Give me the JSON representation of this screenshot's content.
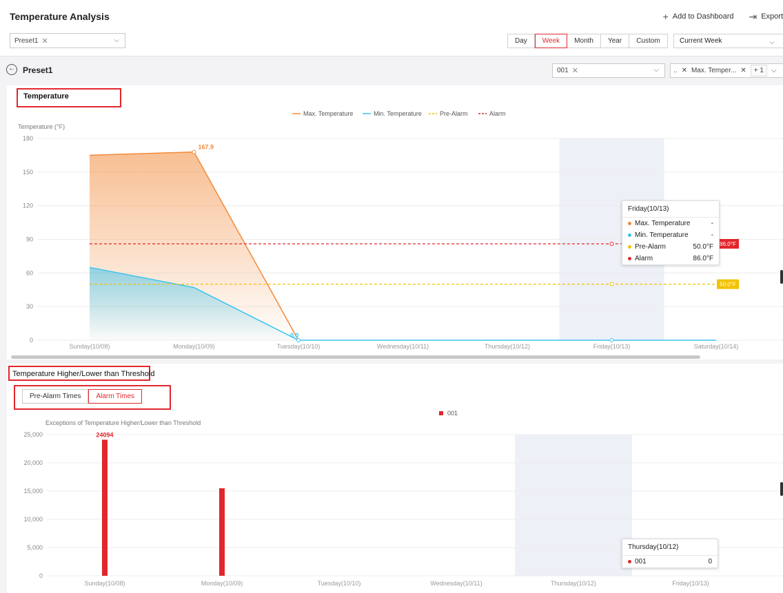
{
  "app": {
    "title": "Temperature Analysis"
  },
  "toolbar": {
    "add_dashboard": "Add to Dashboard",
    "export": "Export"
  },
  "preset_filter": {
    "tag": "Preset1"
  },
  "period_tabs": [
    "Day",
    "Week",
    "Month",
    "Year",
    "Custom"
  ],
  "period_active": "Week",
  "range_select": "Current Week",
  "preset_row": {
    "name": "Preset1",
    "device_tag": "001",
    "metric_prefix": "..",
    "metric_tag": "Max. Temper...",
    "metric_more": "+ 1"
  },
  "chart1": {
    "section_title": "Temperature",
    "ylabel": "Temperature (°F)",
    "tooltip": {
      "title": "Friday(10/13)",
      "rows": [
        {
          "label": "Max. Temperature",
          "value": "-",
          "color": "#f28a3a"
        },
        {
          "label": "Min. Temperature",
          "value": "-",
          "color": "#3bc3ee"
        },
        {
          "label": "Pre-Alarm",
          "value": "50.0°F",
          "color": "#f2c200"
        },
        {
          "label": "Alarm",
          "value": "86.0°F",
          "color": "#e2262d"
        }
      ]
    },
    "alarm_badge": "86.0°F",
    "prealarm_badge": "50.0°F"
  },
  "chart2": {
    "section_title": "Temperature Higher/Lower than Threshold",
    "tabs": [
      "Pre-Alarm Times",
      "Alarm Times"
    ],
    "active_tab": "Alarm Times",
    "ylabel": "Exceptions of Temperature Higher/Lower than Threshold",
    "tooltip": {
      "title": "Thursday(10/12)",
      "rows": [
        {
          "label": "001",
          "value": "0",
          "color": "#e2262d"
        }
      ]
    }
  },
  "colors": {
    "accent": "#e2262d",
    "max": "#f28a3a",
    "min": "#3bc3ee",
    "prealarm": "#f2c200",
    "alarm": "#e2262d"
  },
  "chart_data": [
    {
      "type": "line",
      "x": [
        "Sunday(10/08)",
        "Monday(10/09)",
        "Tuesday(10/10)",
        "Wednesday(10/11)",
        "Thursday(10/12)",
        "Friday(10/13)",
        "Saturday(10/14)"
      ],
      "series": [
        {
          "name": "Max. Temperature",
          "values": [
            165,
            167.9,
            0,
            null,
            null,
            null,
            null
          ]
        },
        {
          "name": "Min. Temperature",
          "values": [
            65,
            47,
            0,
            0,
            0,
            0,
            0
          ]
        },
        {
          "name": "Pre-Alarm",
          "values": [
            50,
            50,
            50,
            50,
            50,
            50,
            50
          ]
        },
        {
          "name": "Alarm",
          "values": [
            86,
            86,
            86,
            86,
            86,
            86,
            86
          ]
        }
      ],
      "data_labels": [
        {
          "series": "Max. Temperature",
          "x": "Monday(10/09)",
          "text": "167.9"
        },
        {
          "series": "Min. Temperature",
          "x": "Tuesday(10/10)",
          "text": "0.0"
        }
      ],
      "yticks": [
        "0",
        "30",
        "60",
        "90",
        "120",
        "150",
        "180"
      ],
      "ylim": [
        0,
        180
      ],
      "highlight": "Friday(10/13)",
      "legend": "top-center",
      "grid": true
    },
    {
      "type": "bar",
      "categories": [
        "Sunday(10/08)",
        "Monday(10/09)",
        "Tuesday(10/10)",
        "Wednesday(10/11)",
        "Thursday(10/12)",
        "Friday(10/13)"
      ],
      "series": [
        {
          "name": "001",
          "values": [
            24094,
            15500,
            0,
            0,
            0,
            0
          ]
        }
      ],
      "data_labels": [
        {
          "x": "Sunday(10/08)",
          "text": "24094"
        }
      ],
      "yticks": [
        "0",
        "5,000",
        "10,000",
        "15,000",
        "20,000",
        "25,000"
      ],
      "ylim": [
        0,
        25000
      ],
      "highlight": "Thursday(10/12)",
      "legend": "top-center",
      "grid": true
    }
  ]
}
